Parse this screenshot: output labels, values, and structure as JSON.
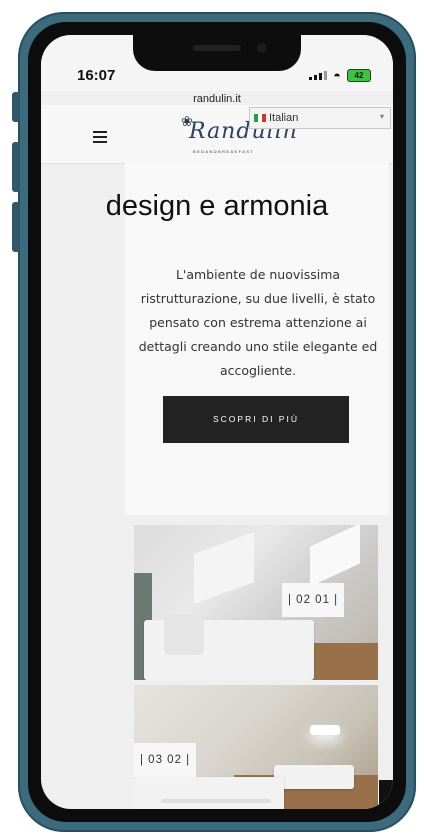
{
  "status": {
    "time": "16:07",
    "battery": "42",
    "url": "randulin.it"
  },
  "header": {
    "logo_text": "Randulin",
    "logo_sub": "BEDANDBREAKFAST",
    "language": "Italian",
    "icons": {
      "menu": "hamburger-icon",
      "bird": "swallow-logo-icon",
      "flag": "italian-flag-icon",
      "caret": "chevron-down-icon"
    }
  },
  "content": {
    "heading": "design e armonia",
    "text": "L'ambiente de nuovissima ristrutturazione, su due livelli, è stato pensato con estrema attenzione ai dettagli creando uno stile elegante ed accogliente.",
    "cta_label": "SCOPRI DI PIÙ"
  },
  "gallery": [
    {
      "label": "| 02   01 |"
    },
    {
      "label": "| 03   02 |"
    }
  ],
  "colors": {
    "frame": "#3c6b7e",
    "button": "#232323",
    "logo": "#2d4160"
  }
}
